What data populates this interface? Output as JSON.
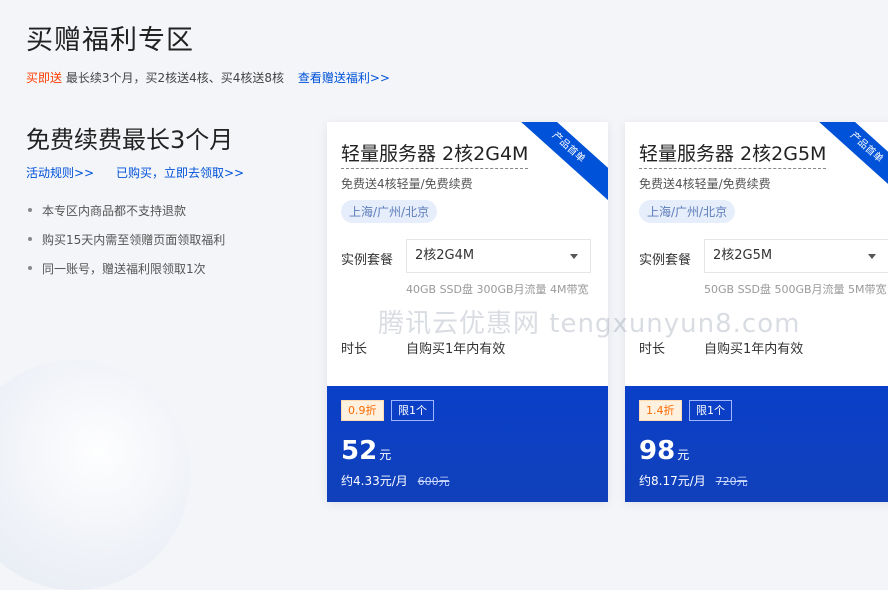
{
  "page": {
    "title": "买赠福利专区",
    "promo": {
      "highlight": "买即送",
      "text": "最长续3个月，买2核送4核、买4核送8核",
      "link": "查看赠送福利>>"
    }
  },
  "left": {
    "title": "免费续费最长3个月",
    "links": [
      "活动规则>>",
      "已购买，立即去领取>>"
    ],
    "rules": [
      "本专区内商品都不支持退款",
      "购买15天内需至领赠页面领取福利",
      "同一账号，赠送福利限领取1次"
    ]
  },
  "cards": [
    {
      "ribbon": "产品首单",
      "title": "轻量服务器 2核2G4M",
      "subtitle": "免费送4核轻量/免费续费",
      "region": "上海/广州/北京",
      "instance_label": "实例套餐",
      "instance_value": "2核2G4M",
      "spec": "40GB SSD盘 300GB月流量 4M带宽",
      "duration_label": "时长",
      "duration_value": "自购买1年内有效",
      "discount": "0.9折",
      "limit": "限1个",
      "price": "52",
      "price_unit": "元",
      "monthly": "约4.33元/月",
      "original": "600元"
    },
    {
      "ribbon": "产品首单",
      "title": "轻量服务器 2核2G5M",
      "subtitle": "免费送4核轻量/免费续费",
      "region": "上海/广州/北京",
      "instance_label": "实例套餐",
      "instance_value": "2核2G5M",
      "spec": "50GB SSD盘 500GB月流量 5M带宽",
      "duration_label": "时长",
      "duration_value": "自购买1年内有效",
      "discount": "1.4折",
      "limit": "限1个",
      "price": "98",
      "price_unit": "元",
      "monthly": "约8.17元/月",
      "original": "720元"
    }
  ],
  "watermark": "腾讯云优惠网 tengxunyun8.com"
}
